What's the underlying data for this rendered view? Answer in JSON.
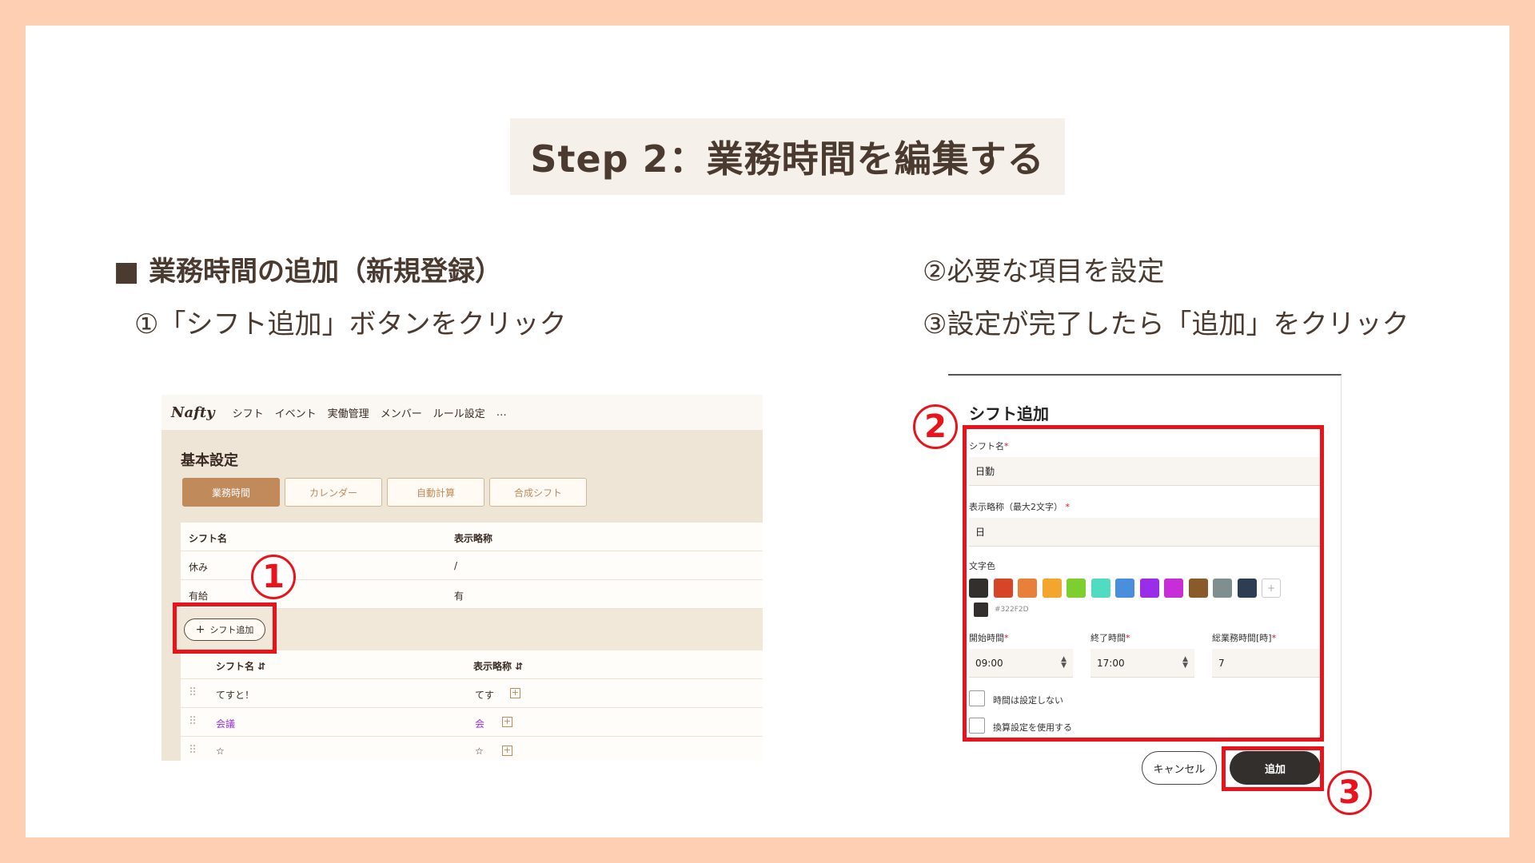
{
  "title": "Step 2：業務時間を編集する",
  "left": {
    "heading": "■ 業務時間の追加（新規登録）",
    "step1": "①「シフト追加」ボタンをクリック"
  },
  "right": {
    "step2": "②必要な項目を設定",
    "step3": "③設定が完了したら「追加」をクリック"
  },
  "markers": {
    "m1": "1",
    "m2": "2",
    "m3": "3"
  },
  "app": {
    "logo": "Nafty",
    "nav": [
      "シフト",
      "イベント",
      "実働管理",
      "メンバー",
      "ルール設定",
      "…"
    ],
    "page_title": "基本設定",
    "tabs": [
      "業務時間",
      "カレンダー",
      "自動計算",
      "合成シフト"
    ],
    "table1": {
      "headers": [
        "シフト名",
        "表示略称"
      ],
      "rows": [
        [
          "休み",
          "/"
        ],
        [
          "有給",
          "有"
        ]
      ]
    },
    "add_button": "シフト追加",
    "table2": {
      "headers": [
        "シフト名 ⇵",
        "表示略称 ⇵"
      ],
      "rows": [
        [
          "てすと！",
          "てす"
        ],
        [
          "会議",
          "会"
        ],
        [
          "☆",
          "☆"
        ]
      ]
    }
  },
  "dialog": {
    "title": "シフト追加",
    "name_label": "シフト名",
    "name_value": "日勤",
    "abbr_label": "表示略称（最大2文字）",
    "abbr_value": "日",
    "color_label": "文字色",
    "colors": [
      "#322f2d",
      "#d64527",
      "#e8803a",
      "#f2a62c",
      "#7ccf2e",
      "#4fdcc0",
      "#4a8fde",
      "#9a2de8",
      "#c72ed8",
      "#8a5a2b",
      "#7f8f8f",
      "#2e3e52"
    ],
    "selected_hex": "#322F2D",
    "start_label": "開始時間",
    "start_value": "09:00",
    "end_label": "終了時間",
    "end_value": "17:00",
    "total_label": "総業務時間[時]",
    "total_value": "7",
    "check1": "時間は設定しない",
    "check2": "換算設定を使用する",
    "cancel": "キャンセル",
    "add": "追加",
    "required_mark": "*",
    "add_swatch": "+"
  },
  "accent_colors": {
    "red": "#e8131b",
    "brown": "#c08a5a",
    "peach": "#ffcfb3",
    "purple": "#9a2de8"
  }
}
